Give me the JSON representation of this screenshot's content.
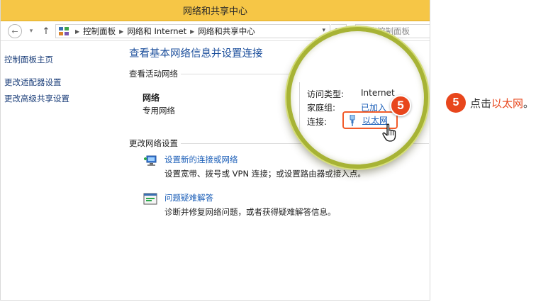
{
  "window": {
    "title": "网络和共享中心"
  },
  "address": {
    "back_glyph": "←",
    "dropdown_glyph": "▾",
    "up_glyph": "↑",
    "crumbs": [
      "控制面板",
      "网络和 Internet",
      "网络和共享中心"
    ],
    "crumb_sep": "▶",
    "refresh_glyph": "↻",
    "search_placeholder": "搜索控制面板"
  },
  "sidebar": {
    "items": [
      {
        "label": "控制面板主页"
      },
      {
        "label": "更改适配器设置"
      },
      {
        "label": "更改高级共享设置"
      }
    ]
  },
  "main": {
    "title": "查看基本网络信息并设置连接",
    "active_section": "查看活动网络",
    "network_name": "网络",
    "network_type": "专用网络",
    "change_section": "更改网络设置",
    "tasks": [
      {
        "link": "设置新的连接或网络",
        "desc": "设置宽带、拨号或 VPN 连接；或设置路由器或接入点。"
      },
      {
        "link": "问题疑难解答",
        "desc": "诊断并修复网络问题，或者获得疑难解答信息。"
      }
    ]
  },
  "magnifier": {
    "access_label": "访问类型:",
    "access_value": "Internet",
    "homegroup_label": "家庭组:",
    "homegroup_value": "已加入",
    "connection_label": "连接:",
    "connection_value": "以太网"
  },
  "instruction": {
    "step": "5",
    "prefix": "点击",
    "highlight": "以太网",
    "suffix": "。"
  },
  "colors": {
    "titlebar": "#f6c646",
    "accent_orange": "#e8461c",
    "link_blue": "#1c5fb8",
    "magnifier_ring": "#a7b335"
  },
  "icons": {
    "connection_setup": "network-connection-icon",
    "troubleshoot": "troubleshoot-icon",
    "ethernet": "ethernet-plug-icon",
    "cursor": "hand-cursor-icon"
  }
}
